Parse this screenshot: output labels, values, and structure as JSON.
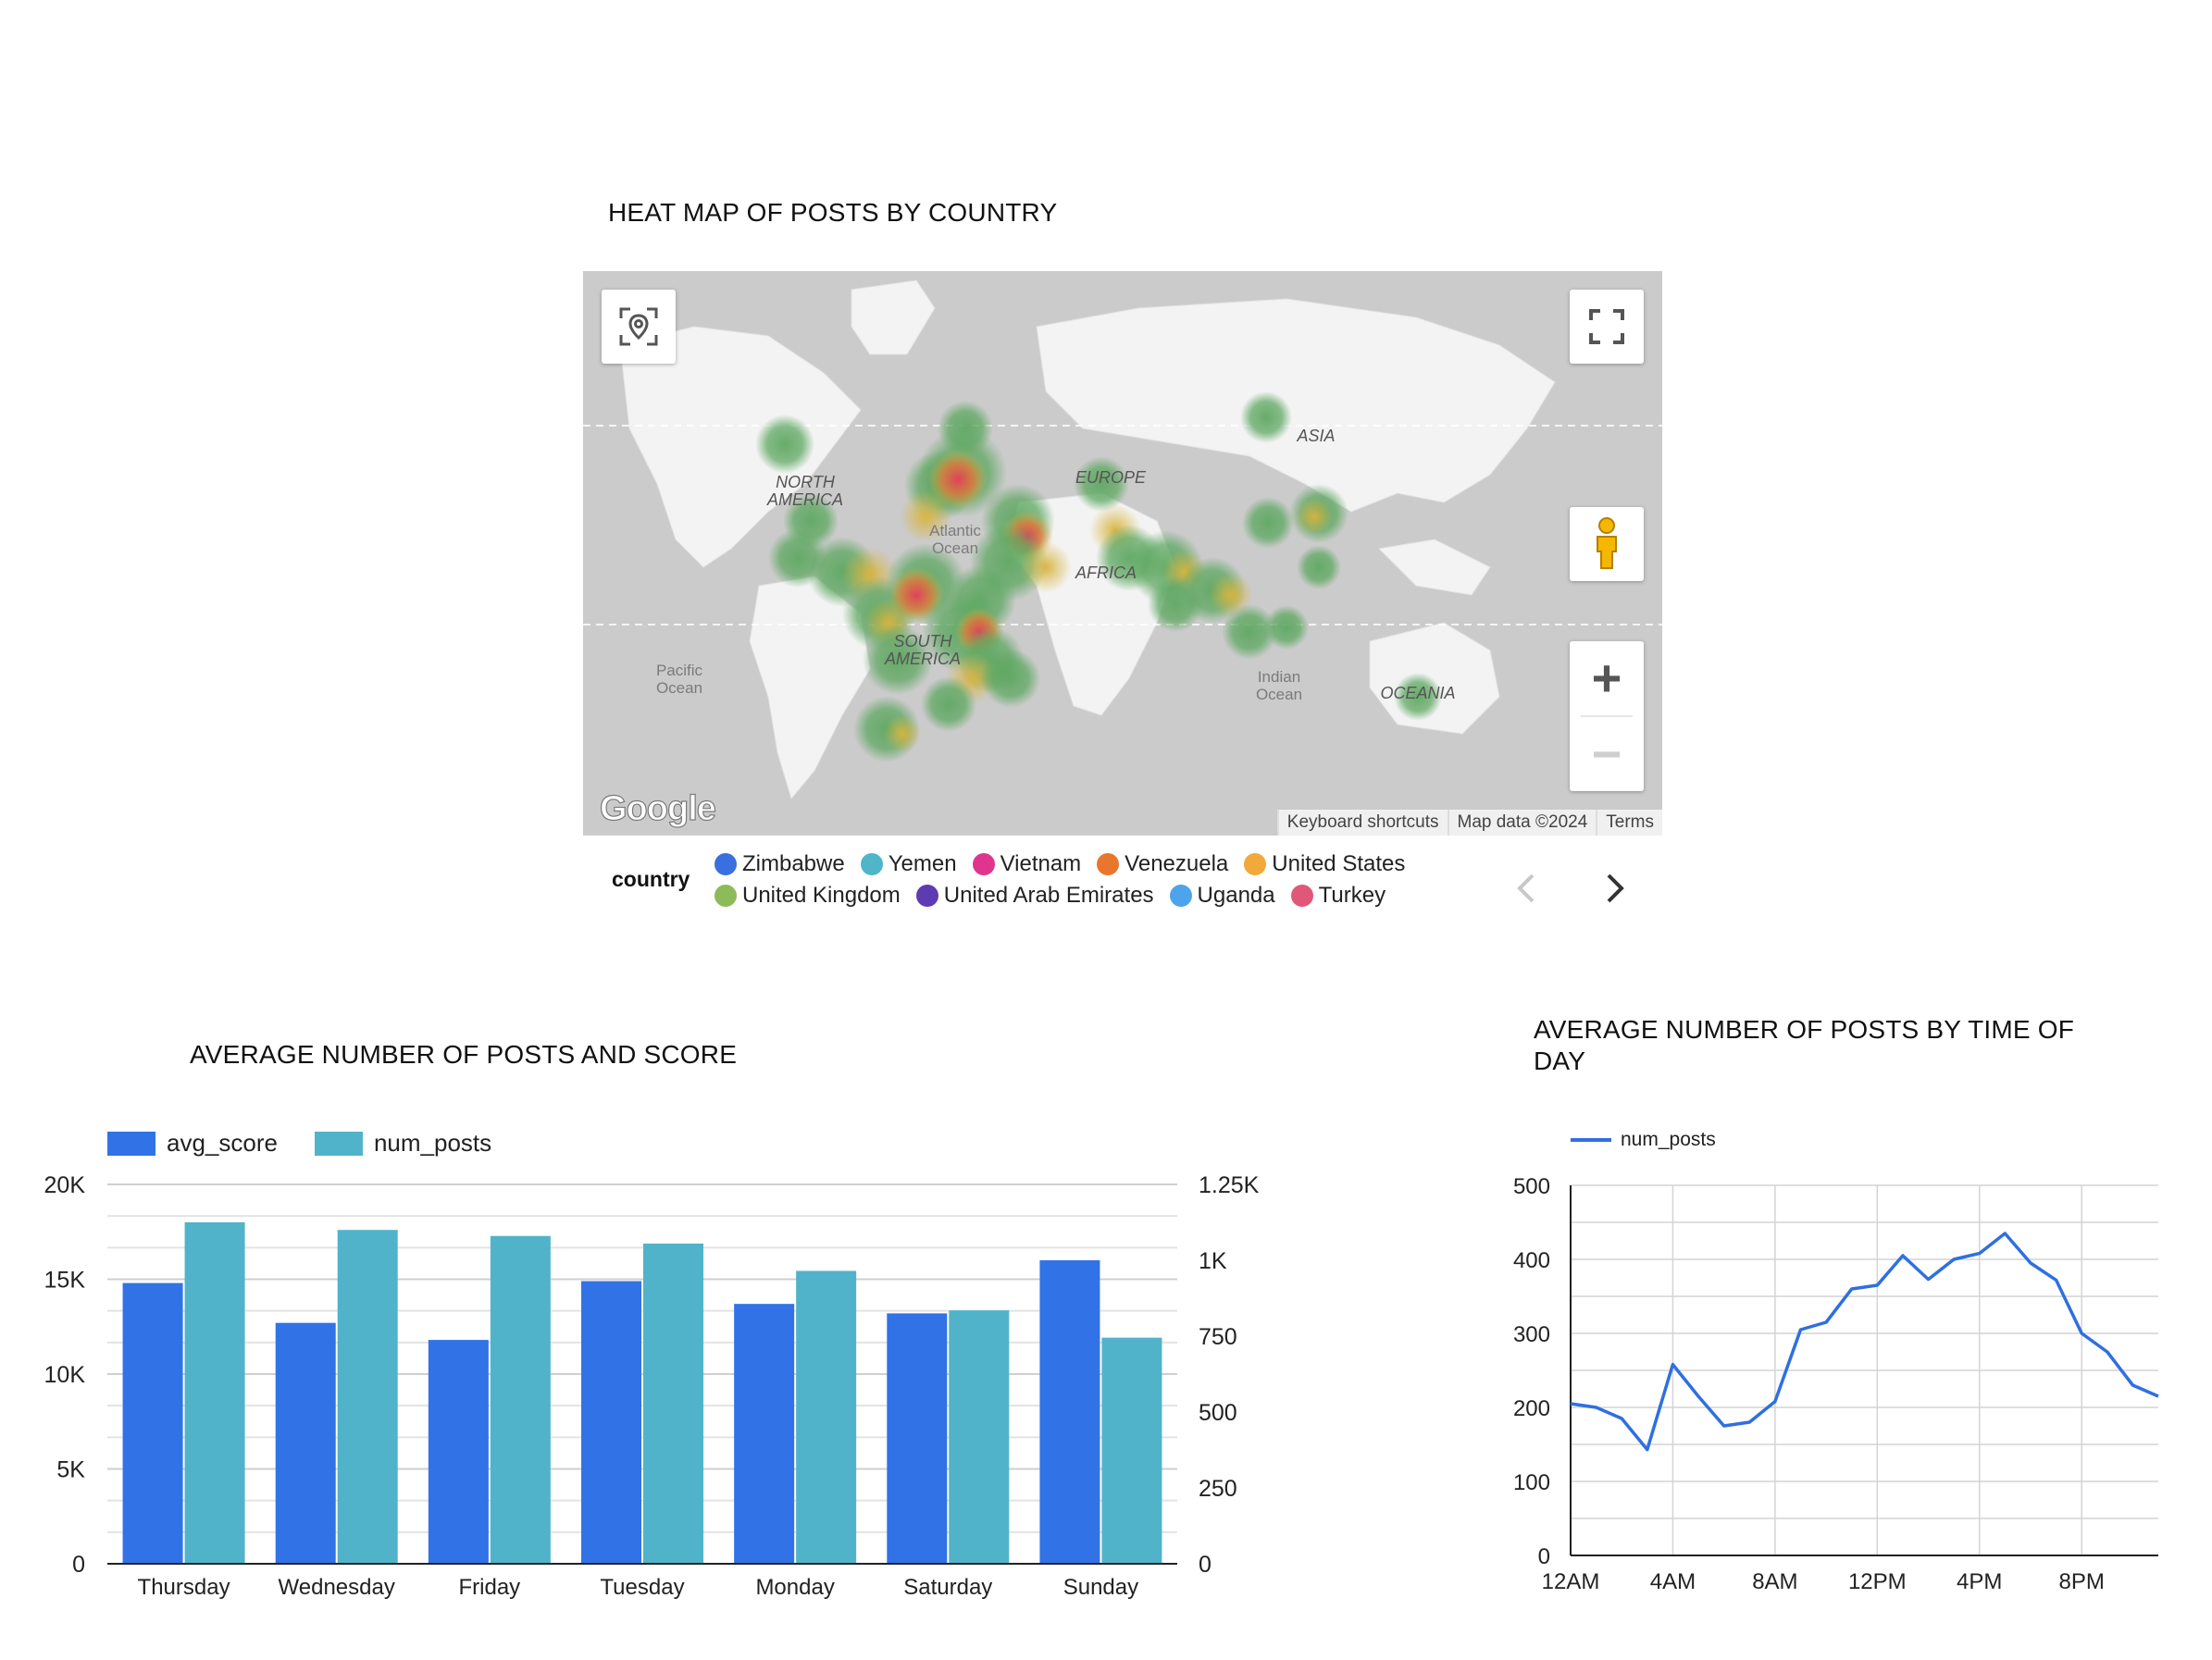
{
  "map_card": {
    "title": "HEAT MAP OF POSTS BY COUNTRY",
    "continent_labels": {
      "north_america_1": "NORTH",
      "north_america_2": "AMERICA",
      "south_america_1": "SOUTH",
      "south_america_2": "AMERICA",
      "europe": "EUROPE",
      "africa": "AFRICA",
      "asia": "ASIA",
      "oceania": "OCEANIA"
    },
    "ocean_labels": {
      "atlantic_1": "Atlantic",
      "atlantic_2": "Ocean",
      "pacific_1": "Pacific",
      "pacific_2": "Ocean",
      "indian_1": "Indian",
      "indian_2": "Ocean"
    },
    "controls": {
      "location_icon": "location-pin-icon",
      "fullscreen_icon": "fullscreen-icon",
      "pegman_icon": "street-view-pegman-icon",
      "zoom_in": "+",
      "zoom_out": "−"
    },
    "google_logo": "Google",
    "attribution": {
      "keyboard": "Keyboard shortcuts",
      "mapdata": "Map data ©2024",
      "terms": "Terms"
    },
    "legend": {
      "title": "country",
      "items": [
        {
          "label": "Zimbabwe",
          "color": "#3a6fe0"
        },
        {
          "label": "Yemen",
          "color": "#4fb5c8"
        },
        {
          "label": "Vietnam",
          "color": "#e0358f"
        },
        {
          "label": "Venezuela",
          "color": "#e8762c"
        },
        {
          "label": "United States",
          "color": "#f2a93b"
        },
        {
          "label": "United Kingdom",
          "color": "#8dbb5a"
        },
        {
          "label": "United Arab Emirates",
          "color": "#5d3bb0"
        },
        {
          "label": "Uganda",
          "color": "#4ea4ec"
        },
        {
          "label": "Turkey",
          "color": "#e0577a"
        }
      ],
      "prev_icon": "chevron-left-icon",
      "next_icon": "chevron-right-icon"
    }
  },
  "bar_card": {
    "title": "AVERAGE NUMBER OF POSTS AND SCORE"
  },
  "line_card": {
    "title": "AVERAGE NUMBER OF POSTS BY TIME OF DAY"
  },
  "chart_data": [
    {
      "type": "bar",
      "title": "AVERAGE NUMBER OF POSTS AND SCORE",
      "categories": [
        "Thursday",
        "Wednesday",
        "Friday",
        "Tuesday",
        "Monday",
        "Saturday",
        "Sunday"
      ],
      "series": [
        {
          "name": "avg_score",
          "axis": "left",
          "color": "#3173e6",
          "values": [
            14800,
            12700,
            11800,
            14900,
            13700,
            13200,
            16000
          ]
        },
        {
          "name": "num_posts",
          "axis": "right",
          "color": "#51b3c9",
          "values": [
            1125,
            1100,
            1080,
            1055,
            965,
            835,
            745
          ]
        }
      ],
      "ylim_left": [
        0,
        20000
      ],
      "ylim_right": [
        0,
        1250
      ],
      "yticks_left": [
        "0",
        "5K",
        "10K",
        "15K",
        "20K"
      ],
      "yticks_right": [
        "0",
        "250",
        "500",
        "750",
        "1K",
        "1.25K"
      ],
      "legend": "top-left",
      "grid": true
    },
    {
      "type": "line",
      "title": "AVERAGE NUMBER OF POSTS BY TIME OF DAY",
      "x": [
        0,
        1,
        2,
        3,
        4,
        5,
        6,
        7,
        8,
        9,
        10,
        11,
        12,
        13,
        14,
        15,
        16,
        17,
        18,
        19,
        20,
        21,
        22,
        23
      ],
      "xticks": [
        "12AM",
        "4AM",
        "8AM",
        "12PM",
        "4PM",
        "8PM"
      ],
      "series": [
        {
          "name": "num_posts",
          "color": "#2f6fe0",
          "values": [
            205,
            200,
            185,
            143,
            258,
            215,
            175,
            180,
            208,
            305,
            315,
            360,
            365,
            405,
            373,
            400,
            408,
            435,
            395,
            372,
            300,
            275,
            230,
            215
          ]
        }
      ],
      "ylim": [
        0,
        500
      ],
      "yticks": [
        "0",
        "100",
        "200",
        "300",
        "400",
        "500"
      ],
      "legend": "top-left",
      "grid": true
    }
  ]
}
